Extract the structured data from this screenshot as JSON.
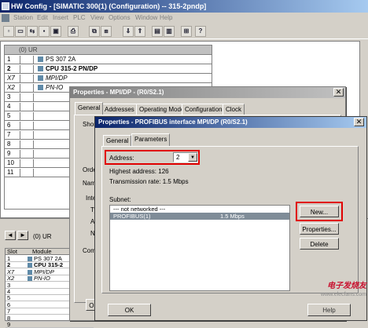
{
  "app": {
    "title": "HW Config - [SIMATIC 300(1) (Configuration) -- 315-2pndp]"
  },
  "menu": [
    "Station",
    "Edit",
    "Insert",
    "PLC",
    "View",
    "Options",
    "Window",
    "Help"
  ],
  "rack": {
    "label": "(0) UR",
    "rows": [
      {
        "slot": "1",
        "module": "PS 307 2A",
        "bold": false,
        "italic": false
      },
      {
        "slot": "2",
        "module": "CPU 315-2 PN/DP",
        "bold": true,
        "italic": false
      },
      {
        "slot": "X7",
        "module": "MPI/DP",
        "bold": false,
        "italic": true
      },
      {
        "slot": "X2",
        "module": "PN-IO",
        "bold": false,
        "italic": true
      },
      {
        "slot": "3",
        "module": ""
      },
      {
        "slot": "4",
        "module": ""
      },
      {
        "slot": "5",
        "module": ""
      },
      {
        "slot": "6",
        "module": ""
      },
      {
        "slot": "7",
        "module": ""
      },
      {
        "slot": "8",
        "module": ""
      },
      {
        "slot": "9",
        "module": ""
      },
      {
        "slot": "10",
        "module": ""
      },
      {
        "slot": "11",
        "module": ""
      }
    ]
  },
  "lower": {
    "nav_label": "(0)  UR",
    "headers": {
      "slot": "Slot",
      "module": "Module"
    },
    "rows": [
      {
        "slot": "1",
        "module": "PS 307 2A",
        "bold": false,
        "italic": false
      },
      {
        "slot": "2",
        "module": "CPU 315-2",
        "bold": true,
        "italic": false
      },
      {
        "slot": "X7",
        "module": "MPI/DP",
        "bold": false,
        "italic": true
      },
      {
        "slot": "X2",
        "module": "PN-IO",
        "bold": false,
        "italic": true
      },
      {
        "slot": "3",
        "module": ""
      },
      {
        "slot": "4",
        "module": ""
      },
      {
        "slot": "5",
        "module": ""
      },
      {
        "slot": "6",
        "module": ""
      },
      {
        "slot": "7",
        "module": ""
      },
      {
        "slot": "8",
        "module": ""
      },
      {
        "slot": "9",
        "module": ""
      }
    ]
  },
  "props_mpi": {
    "title": "Properties - MPI/DP - (R0/S2.1)",
    "tabs": [
      "General",
      "Addresses",
      "Operating Mode",
      "Configuration",
      "Clock"
    ],
    "labels": {
      "short": "Short",
      "order": "Order",
      "name": "Name",
      "interface": "Inte",
      "type": "Typ",
      "address": "Add",
      "networked": "Net",
      "comment": "Comm"
    },
    "ok_label": "OK"
  },
  "props_profibus": {
    "title": "Properties - PROFIBUS interface  MPI/DP (R0/S2.1)",
    "tabs": [
      "General",
      "Parameters"
    ],
    "address_label": "Address:",
    "address_value": "2",
    "highest_address": "Highest address: 126",
    "transmission_rate": "Transmission rate: 1.5 Mbps",
    "subnet_label": "Subnet:",
    "subnet_items": [
      {
        "name": "--- not networked ---",
        "rate": "",
        "selected": false
      },
      {
        "name": "PROFIBUS(1)",
        "rate": "1.5 Mbps",
        "selected": true
      }
    ],
    "buttons": {
      "new": "New...",
      "properties": "Properties...",
      "delete": "Delete",
      "ok": "OK",
      "help": "Help"
    }
  },
  "watermark": {
    "line1": "电子发烧友",
    "line2": "www.elecfans.com"
  },
  "colors": {
    "highlight": "#e00000",
    "selection": "#7f8c98",
    "titlebar": "#0a246a"
  }
}
